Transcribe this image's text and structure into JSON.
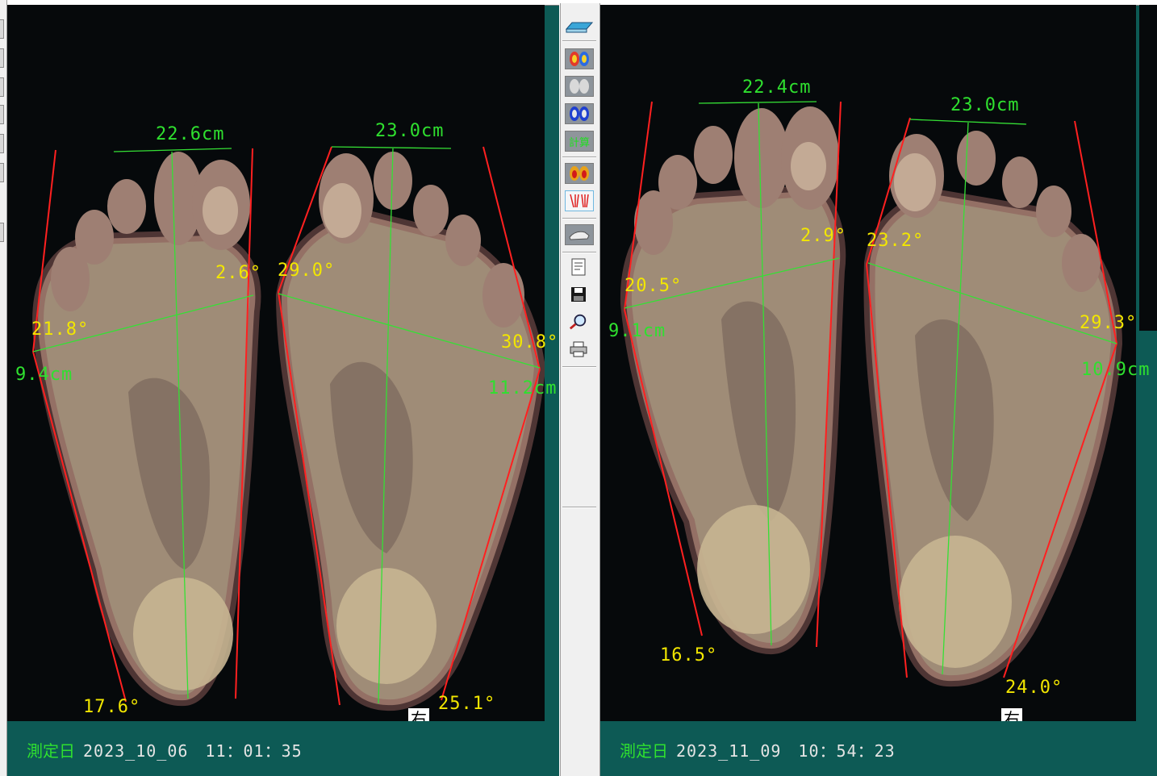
{
  "toolbar": {
    "calc_label": "計算",
    "buttons": [
      {
        "name": "scanner-icon"
      },
      {
        "name": "foot-pressure-color-icon"
      },
      {
        "name": "foot-gray-icon"
      },
      {
        "name": "foot-blue-icon"
      },
      {
        "name": "calculate-button"
      },
      {
        "name": "foot-heatmap-icon"
      },
      {
        "name": "foot-lines-icon"
      },
      {
        "name": "shoe-icon"
      },
      {
        "name": "document-icon"
      },
      {
        "name": "save-icon"
      },
      {
        "name": "search-icon"
      },
      {
        "name": "print-icon"
      }
    ]
  },
  "left_panel": {
    "measure_label": "測定日",
    "timestamp": "2023_10_06　11：01：35",
    "side_marker": "右",
    "foot1": {
      "length": "22.6cm",
      "ball_angle_right": "2.6°",
      "ball_angle_left": "21.8°",
      "width": "9.4cm",
      "heel_angle": "17.6°"
    },
    "foot2": {
      "length": "23.0cm",
      "ball_angle_left": "29.0°",
      "ball_angle_right": "30.8°",
      "width": "11.2cm",
      "heel_angle": "25.1°"
    }
  },
  "right_panel": {
    "measure_label": "測定日",
    "timestamp": "2023_11_09　10：54：23",
    "side_marker": "右",
    "foot1": {
      "length": "22.4cm",
      "ball_angle_right": "2.9°",
      "ball_angle_left": "20.5°",
      "width": "9.1cm",
      "heel_angle": "16.5°"
    },
    "foot2": {
      "length": "23.0cm",
      "ball_angle_left": "23.2°",
      "ball_angle_right": "29.3°",
      "width": "10.9cm",
      "heel_angle": "24.0°"
    }
  },
  "colors": {
    "panel_bg": "#0d5a55",
    "scan_bg": "#06090b",
    "measure_green": "#2fe02f",
    "angle_yellow": "#f2e600",
    "outline_red": "#ff2020"
  }
}
